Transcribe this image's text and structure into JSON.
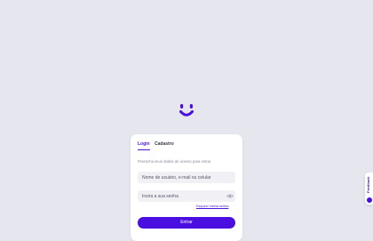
{
  "brand": {
    "logo_icon": "smile-logo-icon",
    "accent_color": "#4a0fe0"
  },
  "login": {
    "tabs": [
      {
        "label": "Login",
        "active": true
      },
      {
        "label": "Cadastro",
        "active": false
      }
    ],
    "hint": "Preencha seus dados de acesso para entrar",
    "username_placeholder": "Nome de usuário, e-mail ou celular",
    "password_placeholder": "Insira a sua senha",
    "password_toggle_icon": "eye-icon",
    "forgot_label": "Esqueci minha senha",
    "submit_label": "Entrar"
  },
  "feedback": {
    "label": "Feedback"
  }
}
